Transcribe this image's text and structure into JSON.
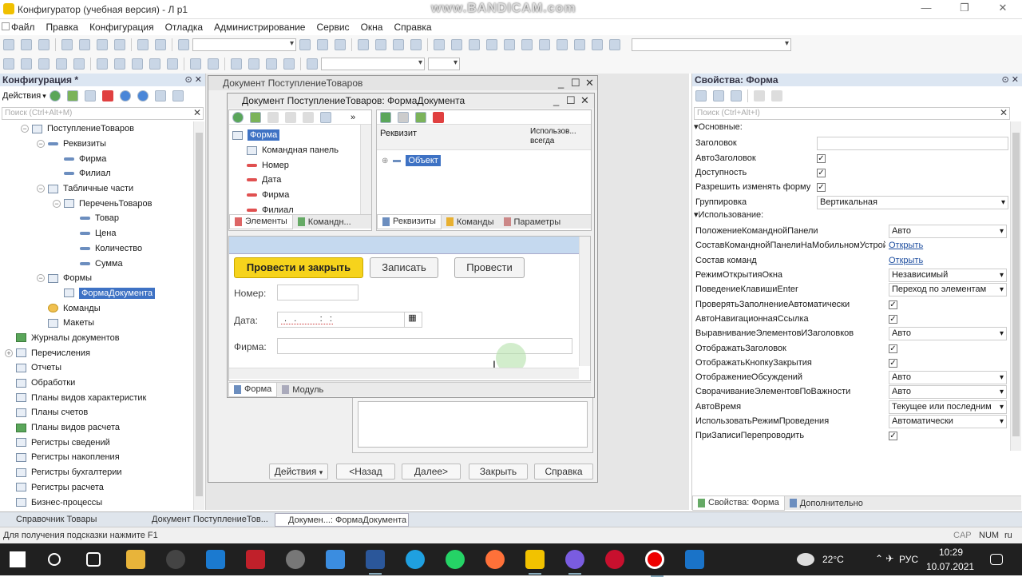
{
  "app": {
    "title": "Конфигуратор (учебная версия) - Л р1",
    "watermark": "www.BANDICAM.com"
  },
  "menu": [
    "Файл",
    "Правка",
    "Конфигурация",
    "Отладка",
    "Администрирование",
    "Сервис",
    "Окна",
    "Справка"
  ],
  "left_panel": {
    "title": "Конфигурация *",
    "actions_label": "Действия",
    "search_placeholder": "Поиск (Ctrl+Alt+M)",
    "tree": [
      {
        "label": "ПоступлениеТоваров",
        "indent": 1,
        "exp": "−",
        "icon": "doc"
      },
      {
        "label": "Реквизиты",
        "indent": 2,
        "exp": "−",
        "icon": "attr"
      },
      {
        "label": "Фирма",
        "indent": 3,
        "icon": "attr"
      },
      {
        "label": "Филиал",
        "indent": 3,
        "icon": "attr"
      },
      {
        "label": "Табличные части",
        "indent": 2,
        "exp": "−",
        "icon": "table"
      },
      {
        "label": "ПереченьТоваров",
        "indent": 3,
        "exp": "−",
        "icon": "table"
      },
      {
        "label": "Товар",
        "indent": 4,
        "icon": "attr"
      },
      {
        "label": "Цена",
        "indent": 4,
        "icon": "attr"
      },
      {
        "label": "Количество",
        "indent": 4,
        "icon": "attr"
      },
      {
        "label": "Сумма",
        "indent": 4,
        "icon": "attr"
      },
      {
        "label": "Формы",
        "indent": 2,
        "exp": "−",
        "icon": "form"
      },
      {
        "label": "ФормаДокумента",
        "indent": 3,
        "icon": "form",
        "selected": true
      },
      {
        "label": "Команды",
        "indent": 2,
        "icon": "cmd"
      },
      {
        "label": "Макеты",
        "indent": 2,
        "icon": "form"
      },
      {
        "label": "Журналы документов",
        "indent": 0,
        "icon": "green"
      },
      {
        "label": "Перечисления",
        "indent": 0,
        "exp": "+",
        "icon": "doc"
      },
      {
        "label": "Отчеты",
        "indent": 0,
        "icon": "doc"
      },
      {
        "label": "Обработки",
        "indent": 0,
        "icon": "doc"
      },
      {
        "label": "Планы видов характеристик",
        "indent": 0,
        "icon": "doc"
      },
      {
        "label": "Планы счетов",
        "indent": 0,
        "icon": "doc"
      },
      {
        "label": "Планы видов расчета",
        "indent": 0,
        "icon": "green"
      },
      {
        "label": "Регистры сведений",
        "indent": 0,
        "icon": "doc"
      },
      {
        "label": "Регистры накопления",
        "indent": 0,
        "icon": "doc"
      },
      {
        "label": "Регистры бухгалтерии",
        "indent": 0,
        "icon": "doc"
      },
      {
        "label": "Регистры расчета",
        "indent": 0,
        "icon": "doc"
      },
      {
        "label": "Бизнес-процессы",
        "indent": 0,
        "icon": "doc"
      }
    ]
  },
  "doc_window": {
    "title": "Документ ПоступлениеТоваров",
    "bottom_buttons": [
      "Действия",
      "<Назад",
      "Далее>",
      "Закрыть",
      "Справка"
    ]
  },
  "form_window": {
    "title": "Документ ПоступлениеТоваров: ФормаДокумента",
    "elements": [
      "Форма",
      "Командная панель",
      "Номер",
      "Дата",
      "Фирма",
      "Филиал"
    ],
    "elements_tabs": [
      "Элементы",
      "Командн..."
    ],
    "attr_header": [
      "Реквизит",
      "Использов... всегда"
    ],
    "attr_items": [
      "Объект"
    ],
    "attr_tabs": [
      "Реквизиты",
      "Команды",
      "Параметры"
    ],
    "preview": {
      "btn_post_close": "Провести и закрыть",
      "btn_write": "Записать",
      "btn_post": "Провести",
      "label_number": "Номер:",
      "label_date": "Дата:",
      "date_mask": " .  .       :  :",
      "label_firm": "Фирма:"
    },
    "bottom_tabs": [
      "Форма",
      "Модуль"
    ]
  },
  "props": {
    "title": "Свойства: Форма",
    "search_placeholder": "Поиск (Ctrl+Alt+I)",
    "sections": [
      {
        "name": "Основные:",
        "rows": [
          {
            "label": "Заголовок",
            "type": "text",
            "value": ""
          },
          {
            "label": "АвтоЗаголовок",
            "type": "check",
            "value": "✓"
          },
          {
            "label": "Доступность",
            "type": "check",
            "value": "✓"
          },
          {
            "label": "Разрешить изменять форму",
            "type": "check",
            "value": "✓"
          },
          {
            "label": "Группировка",
            "type": "select",
            "value": "Вертикальная"
          }
        ]
      },
      {
        "name": "Использование:",
        "rows": [
          {
            "label": "ПоложениеКоманднойПанели",
            "type": "select",
            "value": "Авто"
          },
          {
            "label": "СоставКоманднойПанелиНаМобильномУстройстве",
            "type": "link",
            "value": "Открыть"
          },
          {
            "label": "Состав команд",
            "type": "link",
            "value": "Открыть"
          },
          {
            "label": "РежимОткрытияОкна",
            "type": "select",
            "value": "Независимый"
          },
          {
            "label": "ПоведениеКлавишиEnter",
            "type": "select",
            "value": "Переход по элементам"
          },
          {
            "label": "ПроверятьЗаполнениеАвтоматически",
            "type": "check",
            "value": "✓"
          },
          {
            "label": "АвтоНавигационнаяСсылка",
            "type": "check",
            "value": "✓"
          },
          {
            "label": "ВыравниваниеЭлементовИЗаголовков",
            "type": "select",
            "value": "Авто"
          },
          {
            "label": "ОтображатьЗаголовок",
            "type": "check",
            "value": "✓"
          },
          {
            "label": "ОтображатьКнопкуЗакрытия",
            "type": "check",
            "value": "✓"
          },
          {
            "label": "ОтображениеОбсуждений",
            "type": "select",
            "value": "Авто"
          },
          {
            "label": "СворачиваниеЭлементовПоВажности",
            "type": "select",
            "value": "Авто"
          },
          {
            "label": "АвтоВремя",
            "type": "select",
            "value": "Текущее или последним"
          },
          {
            "label": "ИспользоватьРежимПроведения",
            "type": "select",
            "value": "Автоматически"
          },
          {
            "label": "ПриЗаписиПерепроводить",
            "type": "check",
            "value": "✓"
          }
        ]
      }
    ],
    "tabs": [
      "Свойства: Форма",
      "Дополнительно"
    ]
  },
  "dock_tabs": [
    "Справочник Товары",
    "Документ ПоступлениеТов...",
    "Докумен...: ФормаДокумента"
  ],
  "status": {
    "hint": "Для получения подсказки нажмите F1",
    "cap": "CAP",
    "num": "NUM",
    "lang": "ru"
  },
  "taskbar": {
    "weather": "22°C",
    "lang": "РУС",
    "time": "10:29",
    "date": "10.07.2021"
  },
  "colors": {
    "accent_yellow": "#f6d31c",
    "selection": "#3e72c4",
    "taskbar": "#202020"
  }
}
